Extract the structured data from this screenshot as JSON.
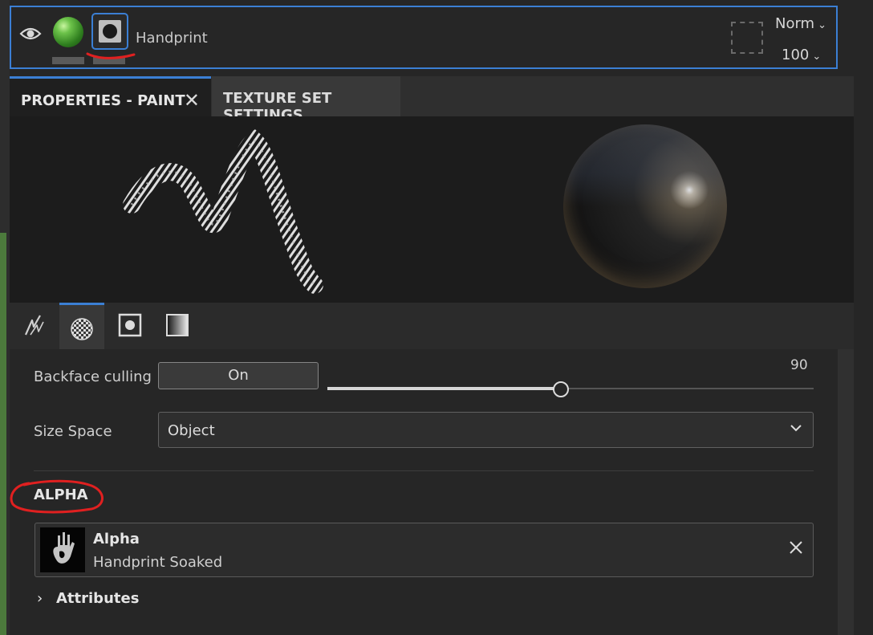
{
  "layer": {
    "name": "Handprint",
    "blend_mode": "Norm",
    "opacity": "100"
  },
  "tabs": {
    "properties": "PROPERTIES - PAINT",
    "texture_set": "TEXTURE SET SETTINGS"
  },
  "settings": {
    "backface_label": "Backface culling",
    "backface_value": "On",
    "angle_value": "90",
    "angle_fraction": 0.48,
    "size_space_label": "Size Space",
    "size_space_value": "Object"
  },
  "alpha": {
    "section_title": "ALPHA",
    "card_title": "Alpha",
    "card_value": "Handprint Soaked"
  },
  "attributes": {
    "label": "Attributes"
  },
  "colors": {
    "accent": "#3b7fd4",
    "annotation": "#e02020"
  },
  "icons": [
    "eye-icon",
    "material-ball-icon",
    "mask-icon",
    "close-icon",
    "brush-tool-icon",
    "checker-tool-icon",
    "alpha-tool-icon",
    "gradient-tool-icon",
    "chevron-down-icon",
    "chevron-right-icon"
  ]
}
